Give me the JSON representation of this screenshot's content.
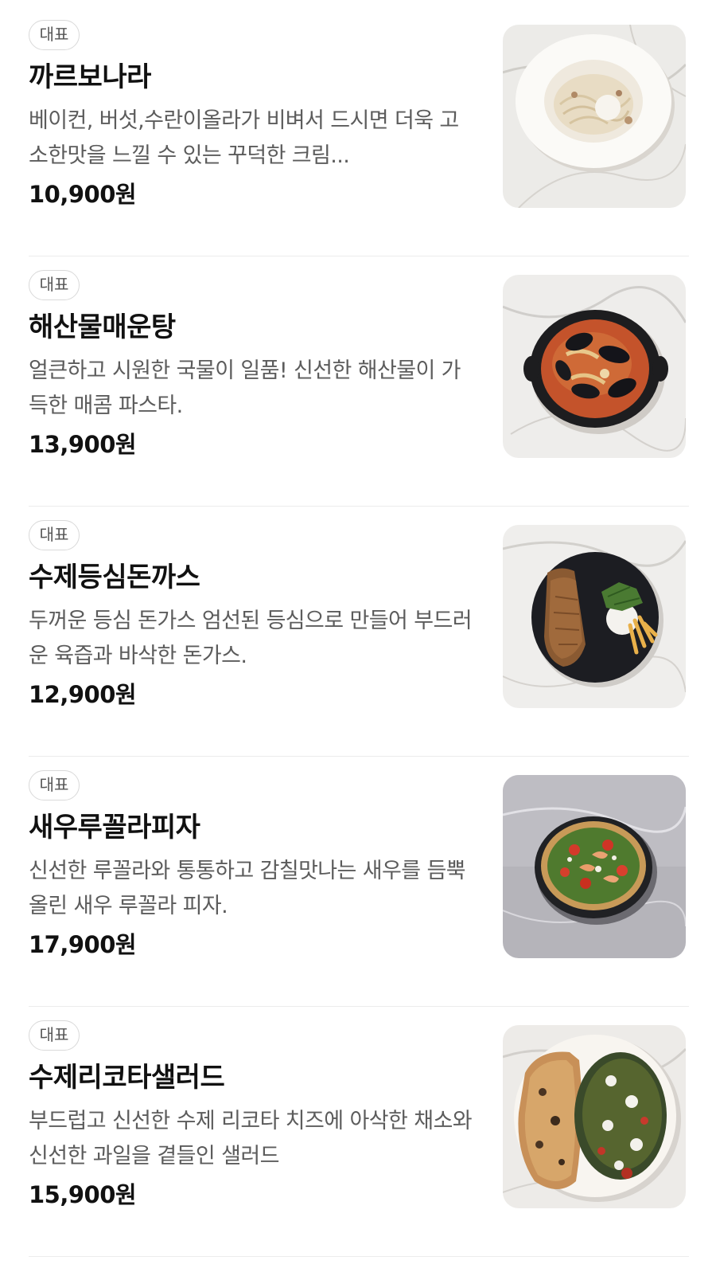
{
  "menu": {
    "items": [
      {
        "badge": "대표",
        "name": "까르보나라",
        "description": "베이컨, 버섯,수란이올라가 비벼서 드시면 더욱 고소한맛을 느낄 수 있는 꾸덕한 크림...",
        "price": "10,900원",
        "image": "carbonara-photo"
      },
      {
        "badge": "대표",
        "name": "해산물매운탕",
        "description": "얼큰하고 시원한 국물이 일품! 신선한 해산물이 가득한 매콤 파스타.",
        "price": "13,900원",
        "image": "seafood-stew-photo"
      },
      {
        "badge": "대표",
        "name": "수제등심돈까스",
        "description": "두꺼운 등심 돈가스 엄선된 등심으로 만들어 부드러운 육즙과 바삭한 돈가스.",
        "price": "12,900원",
        "image": "pork-cutlet-photo"
      },
      {
        "badge": "대표",
        "name": "새우루꼴라피자",
        "description": "신선한 루꼴라와 통통하고 감칠맛나는 새우를 듬뿍 올린 새우 루꼴라 피자.",
        "price": "17,900원",
        "image": "shrimp-arugula-pizza-photo"
      },
      {
        "badge": "대표",
        "name": "수제리코타샐러드",
        "description": "부드럽고 신선한 수제 리코타 치즈에 아삭한 채소와 신선한 과일을 곁들인 샐러드",
        "price": "15,900원",
        "image": "ricotta-salad-photo"
      }
    ]
  }
}
